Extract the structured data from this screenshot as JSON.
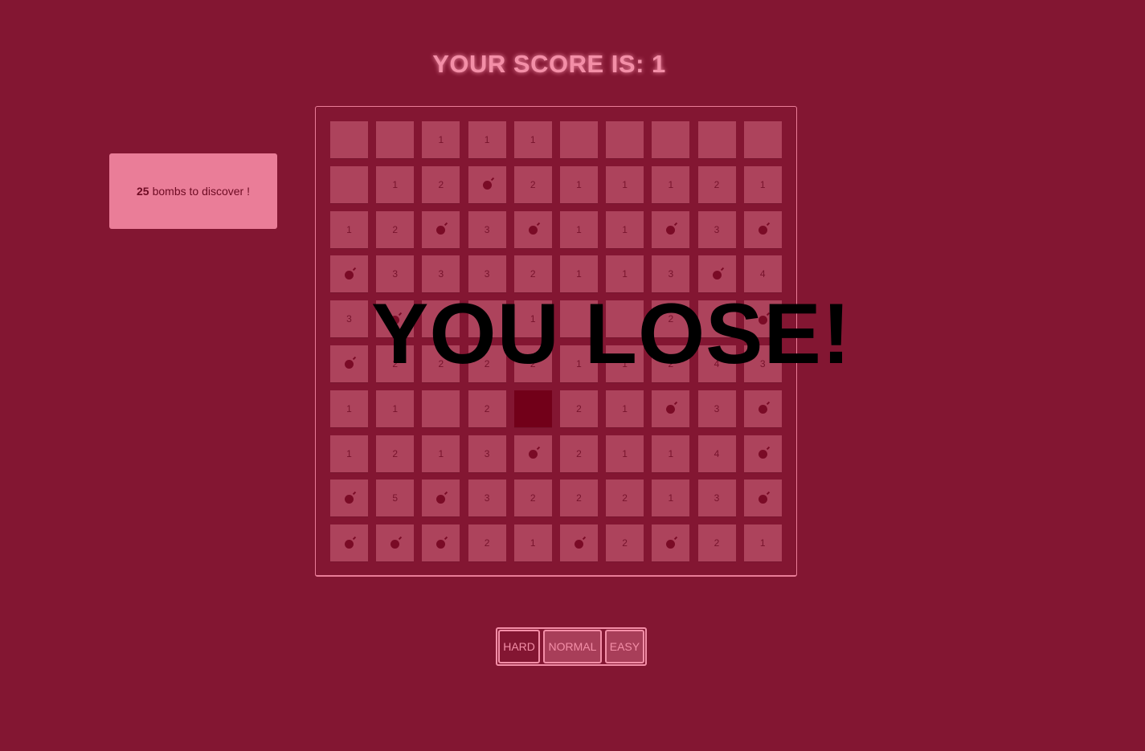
{
  "header": {
    "score_title": "YOUR SCORE IS: 1"
  },
  "counter": {
    "bombs_count": "25",
    "bombs_text": "bombs to discover !"
  },
  "banner": {
    "text": "YOU LOSE!"
  },
  "difficulty": {
    "hard": "HARD",
    "normal": "NORMAL",
    "easy": "EASY",
    "selected": "HARD"
  },
  "board": {
    "rows": [
      [
        "",
        "",
        "1",
        "1",
        "1",
        "",
        "",
        "",
        "",
        ""
      ],
      [
        "",
        "1",
        "2",
        "*",
        "2",
        "1",
        "1",
        "1",
        "2",
        "1"
      ],
      [
        "1",
        "2",
        "*",
        "3",
        "*",
        "1",
        "1",
        "*",
        "3",
        "*"
      ],
      [
        "*",
        "3",
        "3",
        "3",
        "2",
        "1",
        "1",
        "3",
        "*",
        "4"
      ],
      [
        "3",
        "*",
        "",
        "",
        "1",
        "",
        "",
        "2",
        "*",
        "*"
      ],
      [
        "*",
        "2",
        "2",
        "2",
        "2",
        "1",
        "1",
        "2",
        "4",
        "3"
      ],
      [
        "1",
        "1",
        "",
        "2",
        "X",
        "2",
        "1",
        "*",
        "3",
        "*"
      ],
      [
        "1",
        "2",
        "1",
        "3",
        "*",
        "2",
        "1",
        "1",
        "4",
        "*"
      ],
      [
        "*",
        "5",
        "*",
        "3",
        "2",
        "2",
        "2",
        "1",
        "3",
        "*"
      ],
      [
        "*",
        "*",
        "*",
        "2",
        "1",
        "*",
        "2",
        "*",
        "2",
        "1"
      ]
    ]
  },
  "colors": {
    "background": "#831632",
    "cell": "#ad435c",
    "exploded_cell": "#720019",
    "accent": "#f38ea7",
    "counter_box": "#ea7d98"
  },
  "icons": {
    "bomb": "bomb-icon"
  }
}
